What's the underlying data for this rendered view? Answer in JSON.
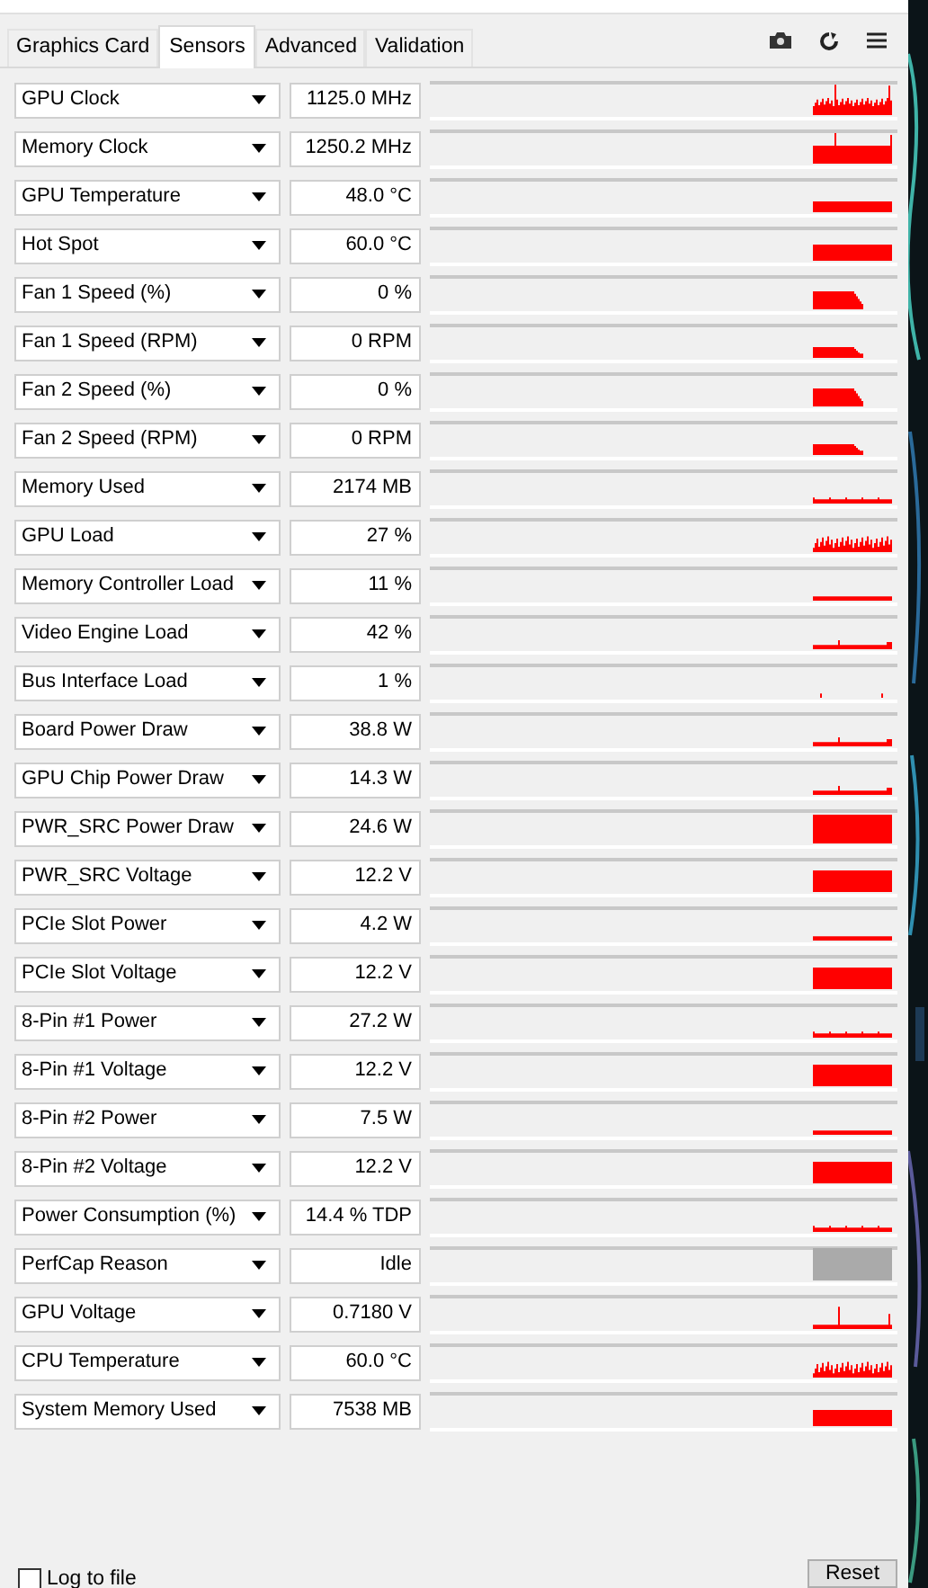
{
  "tabs": [
    {
      "label": "Graphics Card",
      "selected": false
    },
    {
      "label": "Sensors",
      "selected": true
    },
    {
      "label": "Advanced",
      "selected": false
    },
    {
      "label": "Validation",
      "selected": false
    }
  ],
  "sensors": [
    {
      "name": "GPU Clock",
      "value": "1125.0 MHz",
      "color": "#ff0000"
    },
    {
      "name": "Memory Clock",
      "value": "1250.2 MHz",
      "color": "#ff0000"
    },
    {
      "name": "GPU Temperature",
      "value": "48.0 °C",
      "color": "#ff0000"
    },
    {
      "name": "Hot Spot",
      "value": "60.0 °C",
      "color": "#ff0000"
    },
    {
      "name": "Fan 1 Speed (%)",
      "value": "0 %",
      "color": "#ff0000"
    },
    {
      "name": "Fan 1 Speed (RPM)",
      "value": "0 RPM",
      "color": "#ff0000"
    },
    {
      "name": "Fan 2 Speed (%)",
      "value": "0 %",
      "color": "#ff0000"
    },
    {
      "name": "Fan 2 Speed (RPM)",
      "value": "0 RPM",
      "color": "#ff0000"
    },
    {
      "name": "Memory Used",
      "value": "2174 MB",
      "color": "#ff0000"
    },
    {
      "name": "GPU Load",
      "value": "27 %",
      "color": "#ff0000"
    },
    {
      "name": "Memory Controller Load",
      "value": "11 %",
      "color": "#ff0000"
    },
    {
      "name": "Video Engine Load",
      "value": "42 %",
      "color": "#ff0000"
    },
    {
      "name": "Bus Interface Load",
      "value": "1 %",
      "color": "#ff0000"
    },
    {
      "name": "Board Power Draw",
      "value": "38.8 W",
      "color": "#ff0000"
    },
    {
      "name": "GPU Chip Power Draw",
      "value": "14.3 W",
      "color": "#ff0000"
    },
    {
      "name": "PWR_SRC Power Draw",
      "value": "24.6 W",
      "color": "#ff0000"
    },
    {
      "name": "PWR_SRC Voltage",
      "value": "12.2 V",
      "color": "#ff0000"
    },
    {
      "name": "PCIe Slot Power",
      "value": "4.2 W",
      "color": "#ff0000"
    },
    {
      "name": "PCIe Slot Voltage",
      "value": "12.2 V",
      "color": "#ff0000"
    },
    {
      "name": "8-Pin #1 Power",
      "value": "27.2 W",
      "color": "#ff0000"
    },
    {
      "name": "8-Pin #1 Voltage",
      "value": "12.2 V",
      "color": "#ff0000"
    },
    {
      "name": "8-Pin #2 Power",
      "value": "7.5 W",
      "color": "#ff0000"
    },
    {
      "name": "8-Pin #2 Voltage",
      "value": "12.2 V",
      "color": "#ff0000"
    },
    {
      "name": "Power Consumption (%)",
      "value": "14.4 % TDP",
      "color": "#ff0000"
    },
    {
      "name": "PerfCap Reason",
      "value": "Idle",
      "color": "#aaaaaa"
    },
    {
      "name": "GPU Voltage",
      "value": "0.7180 V",
      "color": "#ff0000"
    },
    {
      "name": "CPU Temperature",
      "value": "60.0 °C",
      "color": "#ff0000"
    },
    {
      "name": "System Memory Used",
      "value": "7538 MB",
      "color": "#ff0000"
    }
  ],
  "log_to_file": {
    "label": "Log to file",
    "checked": false
  },
  "reset_button": "Reset"
}
